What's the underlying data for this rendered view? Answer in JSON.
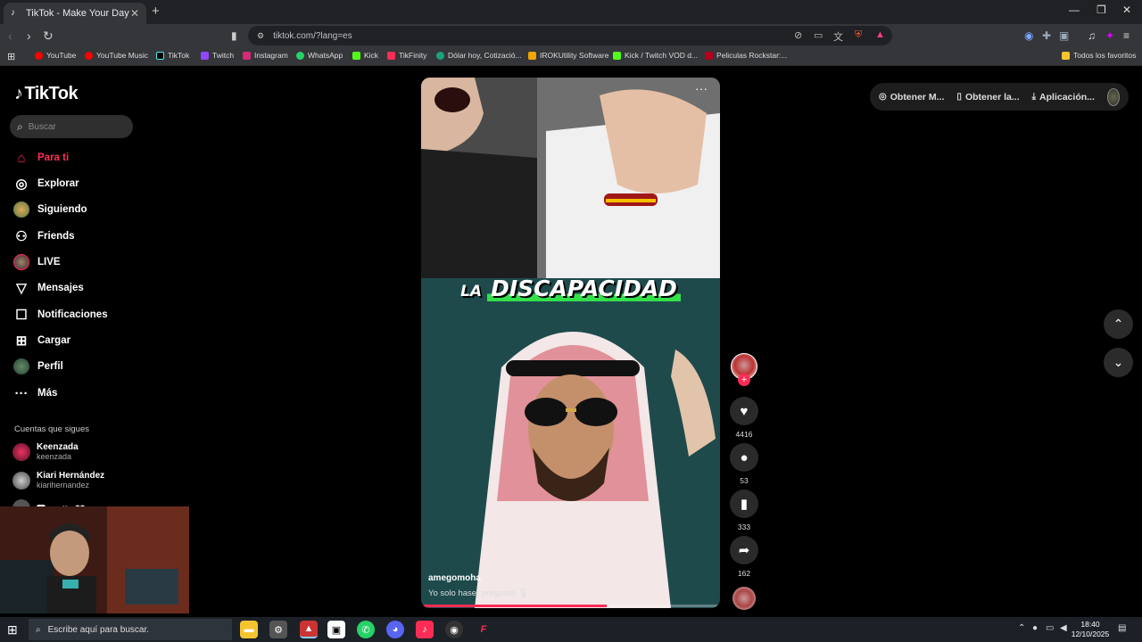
{
  "browser": {
    "tab_title": "TikTok - Make Your Day",
    "url": "tiktok.com/?lang=es",
    "bookmarks": [
      {
        "label": "YouTube",
        "color": "#ff0000"
      },
      {
        "label": "YouTube Music",
        "color": "#ff0000"
      },
      {
        "label": "TikTok",
        "color": "#000000"
      },
      {
        "label": "Twitch",
        "color": "#9146ff"
      },
      {
        "label": "Instagram",
        "color": "#d62976"
      },
      {
        "label": "WhatsApp",
        "color": "#25d366"
      },
      {
        "label": "Kick",
        "color": "#53fc18"
      },
      {
        "label": "TikFinity",
        "color": "#fe2c55"
      },
      {
        "label": "Dólar hoy, Cotizació...",
        "color": "#1aa37a"
      },
      {
        "label": "IROKUtility Software",
        "color": "#f0a500"
      },
      {
        "label": "Kick / Twitch VOD d...",
        "color": "#53fc18"
      },
      {
        "label": "Peliculas Rockstar:...",
        "color": "#b3001b"
      }
    ],
    "all_bookmarks": "Todos los favoritos"
  },
  "tiktok": {
    "logo": "TikTok",
    "search_placeholder": "Buscar",
    "nav": [
      {
        "label": "Para ti",
        "icon": "home-icon",
        "active": true
      },
      {
        "label": "Explorar",
        "icon": "compass-icon"
      },
      {
        "label": "Siguiendo",
        "icon": "avatar"
      },
      {
        "label": "Friends",
        "icon": "friends-icon"
      },
      {
        "label": "LIVE",
        "icon": "live-icon"
      },
      {
        "label": "Mensajes",
        "icon": "send-icon"
      },
      {
        "label": "Notificaciones",
        "icon": "inbox-icon"
      },
      {
        "label": "Cargar",
        "icon": "plus-icon"
      },
      {
        "label": "Perfil",
        "icon": "avatar"
      },
      {
        "label": "Más",
        "icon": "more-icon"
      }
    ],
    "following_heading": "Cuentas que sigues",
    "following": [
      {
        "name": "Keenzada",
        "username": "keenzada"
      },
      {
        "name": "Kiari Hernández",
        "username": "kiarihernandez"
      },
      {
        "name": "🅼Marffx 🤍",
        "username": ""
      }
    ],
    "top_actions": [
      {
        "label": "Obtener M...",
        "icon": "coin-icon"
      },
      {
        "label": "Obtener la...",
        "icon": "phone-icon"
      },
      {
        "label": "Aplicación...",
        "icon": "download-icon"
      }
    ],
    "video": {
      "caption_small": "LA",
      "caption_big": "DISCAPACIDAD",
      "username": "amegomoha",
      "description": "Yo solo haser pregunta 🎙",
      "progress": 0.62,
      "likes": "4416",
      "comments": "53",
      "saves": "333",
      "shares": "162"
    }
  },
  "taskbar": {
    "search_placeholder": "Escribe aquí para buscar.",
    "time": "18:40",
    "date": "12/10/2025"
  }
}
